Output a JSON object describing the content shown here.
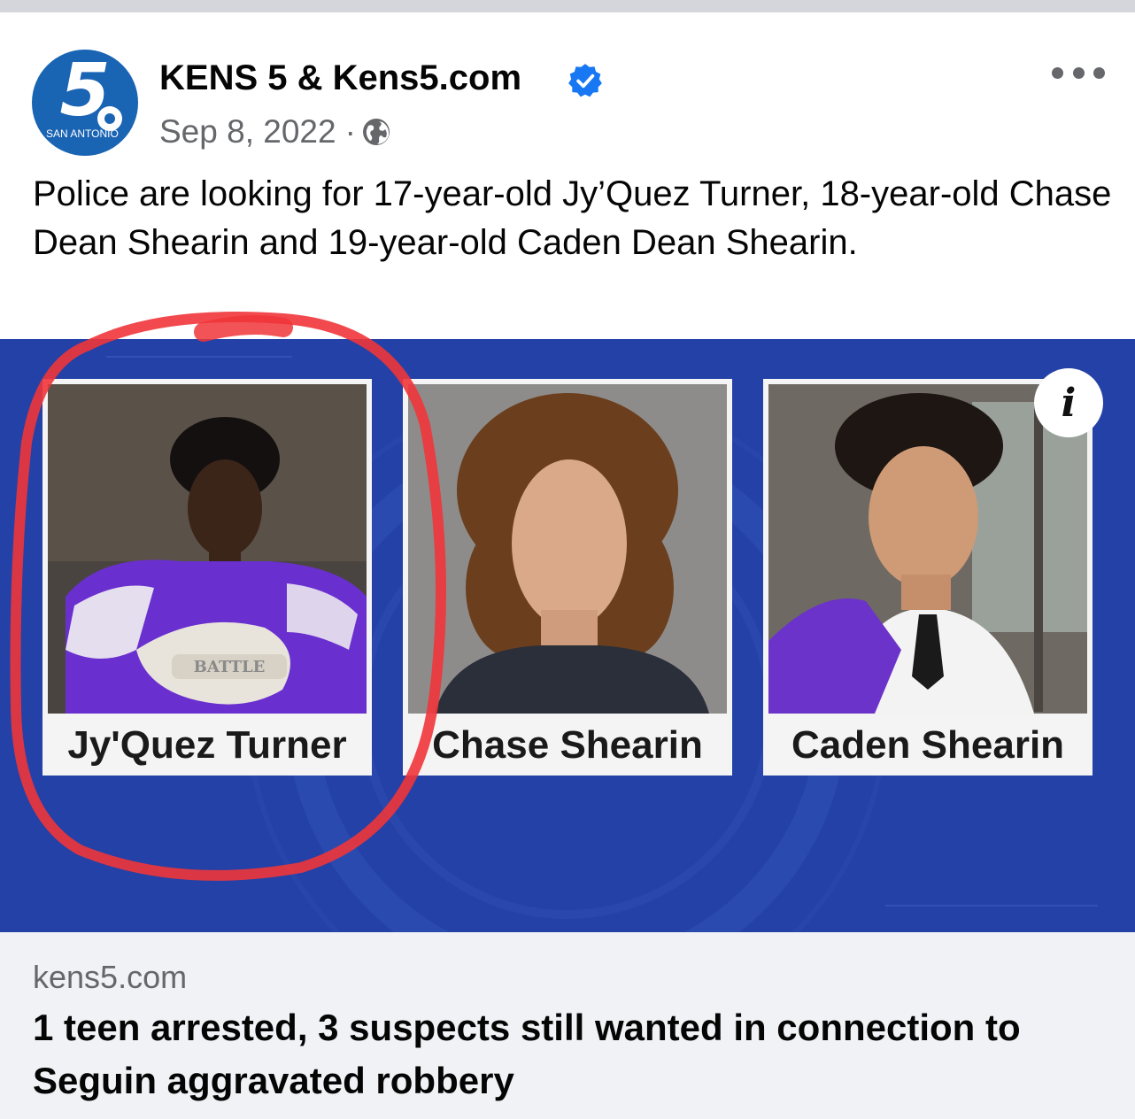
{
  "post": {
    "page_name": "KENS 5 & Kens5.com",
    "avatar_number": "5",
    "avatar_city": "SAN ANTONIO",
    "date": "Sep 8, 2022",
    "separator": "·",
    "audience_icon": "globe-icon",
    "verified_icon": "verified-badge-icon",
    "more_icon": "more-options-icon",
    "text": "Police are looking for 17-year-old Jy’Quez Turner, 18-year-old Chase Dean Shearin and 19-year-old Caden Dean Shearin."
  },
  "image": {
    "background_color": "#2341a6",
    "highlight_color": "#f0353a",
    "info_label": "i",
    "suspects": [
      {
        "name": "Jy'Quez Turner"
      },
      {
        "name": "Chase Shearin"
      },
      {
        "name": "Caden Shearin"
      }
    ]
  },
  "link_preview": {
    "domain": "kens5.com",
    "title": "1 teen arrested, 3 suspects still wanted in connection to Seguin aggravated robbery"
  },
  "colors": {
    "brand_blue": "#1a64b4",
    "verified_blue": "#1877f2",
    "meta_gray": "#65676b"
  }
}
